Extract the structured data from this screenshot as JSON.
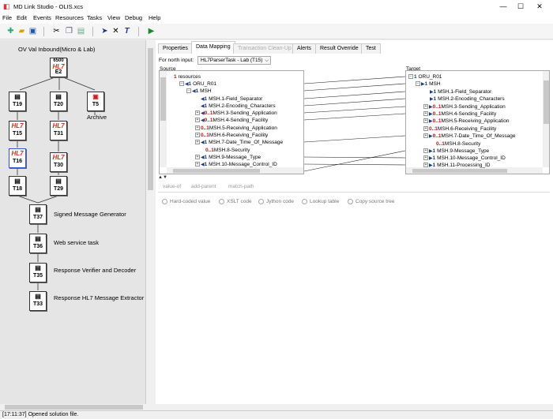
{
  "window": {
    "title": "MD Link Studio - OLIS.xcs",
    "minimize": "—",
    "maximize": "☐",
    "close": "✕"
  },
  "menu": [
    "File",
    "Edit",
    "Events",
    "Resources",
    "Tasks",
    "View",
    "Debug",
    "Help"
  ],
  "toolbar": {
    "icons": [
      "new-icon",
      "open-icon",
      "save-icon",
      "cut-icon",
      "copy-icon",
      "paste-icon",
      "pointer-icon",
      "delete-icon",
      "text-icon",
      "run-icon"
    ]
  },
  "canvas": {
    "title": "OV Val Inbound(Micro & Lab)",
    "nodes": [
      {
        "tag": "E2",
        "glyph": "6500\nHL7"
      },
      {
        "tag": "T19",
        "glyph": "▤"
      },
      {
        "tag": "T20",
        "glyph": "▤"
      },
      {
        "tag": "T5",
        "glyph": "▣"
      },
      {
        "tag": "T15",
        "glyph": "HL7"
      },
      {
        "tag": "T31",
        "glyph": "HL7"
      },
      {
        "tag": "T16",
        "glyph": "HL7"
      },
      {
        "tag": "T30",
        "glyph": "HL7"
      },
      {
        "tag": "T18",
        "glyph": "▤"
      },
      {
        "tag": "T29",
        "glyph": "▤"
      },
      {
        "tag": "T37",
        "glyph": "▤"
      },
      {
        "tag": "T36",
        "glyph": "▤"
      },
      {
        "tag": "T35",
        "glyph": "▤"
      },
      {
        "tag": "T33",
        "glyph": "▤"
      }
    ],
    "labels": {
      "archive": "Archive",
      "signed": "Signed Message Generator",
      "webservice": "Web service task",
      "verifier": "Response Verifier and Decoder",
      "extractor": "Response HL7 Message Extractor"
    }
  },
  "tabs": [
    {
      "label": "Properties",
      "state": "normal"
    },
    {
      "label": "Data Mapping",
      "state": "active"
    },
    {
      "label": "Transaction Clean-Up",
      "state": "disabled"
    },
    {
      "label": "Alerts",
      "state": "normal"
    },
    {
      "label": "Result Override",
      "state": "normal"
    },
    {
      "label": "Test",
      "state": "normal"
    }
  ],
  "mapping": {
    "for_input_label": "For north input:",
    "for_input_value": "HL7ParserTask - Lab  (T15)",
    "source_label": "Source",
    "target_label": "Target",
    "source_rows": [
      {
        "card": "1",
        "name": "resources"
      },
      {
        "card": "1",
        "name": "ORU_R01"
      },
      {
        "card": "1",
        "name": "MSH"
      },
      {
        "card": "1",
        "name": "MSH.1-Field_Separator"
      },
      {
        "card": "1",
        "name": "MSH.2-Encoding_Characters"
      },
      {
        "card": "0..1",
        "name": "MSH.3-Sending_Application"
      },
      {
        "card": "0..1",
        "name": "MSH.4-Sending_Facility"
      },
      {
        "card": "0..1",
        "name": "MSH.5-Receiving_Application"
      },
      {
        "card": "0..1",
        "name": "MSH.6-Receiving_Facility"
      },
      {
        "card": "1",
        "name": "MSH.7-Date_Time_Of_Message"
      },
      {
        "card": "0..1",
        "name": "MSH.8-Security"
      },
      {
        "card": "1",
        "name": "MSH.9-Message_Type"
      },
      {
        "card": "1",
        "name": "MSH.10-Message_Control_ID"
      }
    ],
    "target_rows": [
      {
        "card": "1",
        "name": "ORU_R01"
      },
      {
        "card": "1",
        "name": "MSH"
      },
      {
        "card": "1",
        "name": "MSH.1-Field_Separator"
      },
      {
        "card": "1",
        "name": "MSH.2-Encoding_Characters"
      },
      {
        "card": "0..1",
        "name": "MSH.3-Sending_Application"
      },
      {
        "card": "0..1",
        "name": "MSH.4-Sending_Facility"
      },
      {
        "card": "0..1",
        "name": "MSH.5-Receiving_Application"
      },
      {
        "card": "0..1",
        "name": "MSH.6-Receiving_Facility"
      },
      {
        "card": "0..1",
        "name": "MSH.7-Date_Time_Of_Message"
      },
      {
        "card": "0..1",
        "name": "MSH.8-Security"
      },
      {
        "card": "1",
        "name": "MSH.9-Message_Type"
      },
      {
        "card": "1",
        "name": "MSH.10-Message_Control_ID"
      },
      {
        "card": "1",
        "name": "MSH.11-Processing_ID"
      }
    ],
    "subtabs": [
      "value-of",
      "add-parent",
      "match-path"
    ],
    "options": [
      "Hard-coded value",
      "XSLT code",
      "Jython code",
      "Lookup table",
      "Copy source tree"
    ]
  },
  "status": "[17:11:37]  Opened solution file."
}
